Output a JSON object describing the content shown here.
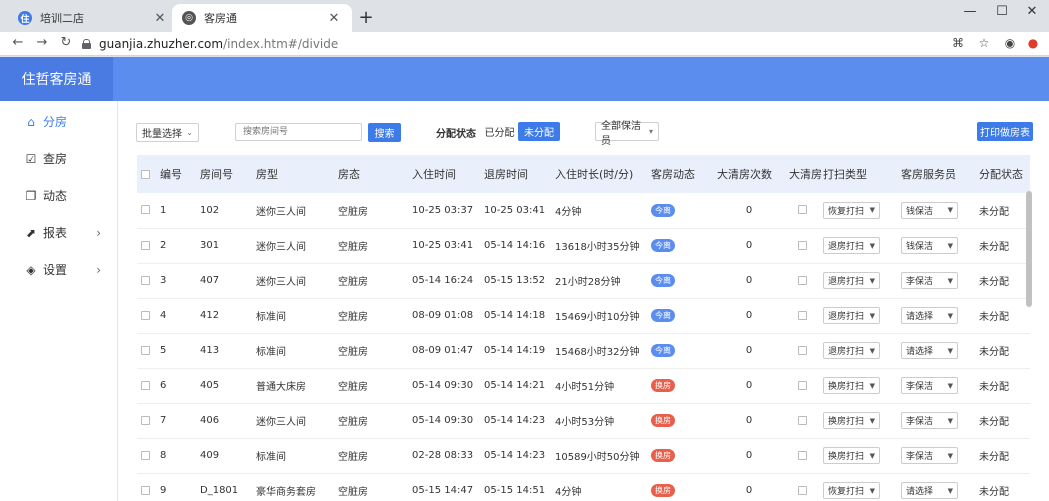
{
  "browser": {
    "tabs": [
      {
        "title": "培训二店",
        "favicon_color": "#3d7be8",
        "favicon_glyph": "住"
      },
      {
        "title": "客房通",
        "favicon_color": "#555555",
        "favicon_glyph": "◎"
      }
    ],
    "url_host": "guanjia.zhuzher.com",
    "url_path": "/index.htm#/divide"
  },
  "app": {
    "brand": "住哲客房通",
    "accent": "#3d7be8",
    "header_color": "#5b8def"
  },
  "sidebar": {
    "items": [
      {
        "label": "分房",
        "icon": "home-icon",
        "glyph": "⌂",
        "active": true,
        "has_arrow": false
      },
      {
        "label": "查房",
        "icon": "checklist-icon",
        "glyph": "☑",
        "active": false,
        "has_arrow": false
      },
      {
        "label": "动态",
        "icon": "activity-icon",
        "glyph": "❐",
        "active": false,
        "has_arrow": false
      },
      {
        "label": "报表",
        "icon": "chart-icon",
        "glyph": "⬈",
        "active": false,
        "has_arrow": true
      },
      {
        "label": "设置",
        "icon": "settings-icon",
        "glyph": "◈",
        "active": false,
        "has_arrow": true
      }
    ]
  },
  "filters": {
    "batch_select": "批量选择",
    "search_placeholder": "搜索房间号",
    "search_button": "搜索",
    "status_label": "分配状态",
    "status_assigned": "已分配",
    "status_unassigned": "未分配",
    "cleaner_select": "全部保洁员",
    "print_button": "打印做房表"
  },
  "table": {
    "headers": [
      "编号",
      "房间号",
      "房型",
      "房态",
      "入住时间",
      "退房时间",
      "入住时长(时/分)",
      "客房动态",
      "大清房次数",
      "大清房",
      "打扫类型",
      "客房服务员",
      "分配状态"
    ],
    "rows": [
      {
        "no": "1",
        "room": "102",
        "type": "迷你三人间",
        "state": "空脏房",
        "checkin": "10-25 03:37",
        "checkout": "10-25 03:41",
        "duration": "4分钟",
        "dyn": "今离",
        "dyn_color": "#5b8def",
        "deep": "0",
        "clean": "恢复打扫",
        "staff": "钱保洁",
        "status": "未分配"
      },
      {
        "no": "2",
        "room": "301",
        "type": "迷你三人间",
        "state": "空脏房",
        "checkin": "10-25 03:41",
        "checkout": "05-14 14:16",
        "duration": "13618小时35分钟",
        "dyn": "今离",
        "dyn_color": "#5b8def",
        "deep": "0",
        "clean": "退房打扫",
        "staff": "钱保洁",
        "status": "未分配"
      },
      {
        "no": "3",
        "room": "407",
        "type": "迷你三人间",
        "state": "空脏房",
        "checkin": "05-14 16:24",
        "checkout": "05-15 13:52",
        "duration": "21小时28分钟",
        "dyn": "今离",
        "dyn_color": "#5b8def",
        "deep": "0",
        "clean": "退房打扫",
        "staff": "李保洁",
        "status": "未分配"
      },
      {
        "no": "4",
        "room": "412",
        "type": "标准间",
        "state": "空脏房",
        "checkin": "08-09 01:08",
        "checkout": "05-14 14:18",
        "duration": "15469小时10分钟",
        "dyn": "今离",
        "dyn_color": "#5b8def",
        "deep": "0",
        "clean": "退房打扫",
        "staff": "请选择",
        "status": "未分配"
      },
      {
        "no": "5",
        "room": "413",
        "type": "标准间",
        "state": "空脏房",
        "checkin": "08-09 01:47",
        "checkout": "05-14 14:19",
        "duration": "15468小时32分钟",
        "dyn": "今离",
        "dyn_color": "#5b8def",
        "deep": "0",
        "clean": "退房打扫",
        "staff": "请选择",
        "status": "未分配"
      },
      {
        "no": "6",
        "room": "405",
        "type": "普通大床房",
        "state": "空脏房",
        "checkin": "05-14 09:30",
        "checkout": "05-14 14:21",
        "duration": "4小时51分钟",
        "dyn": "换房",
        "dyn_color": "#e8604c",
        "deep": "0",
        "clean": "换房打扫",
        "staff": "李保洁",
        "status": "未分配"
      },
      {
        "no": "7",
        "room": "406",
        "type": "迷你三人间",
        "state": "空脏房",
        "checkin": "05-14 09:30",
        "checkout": "05-14 14:23",
        "duration": "4小时53分钟",
        "dyn": "换房",
        "dyn_color": "#e8604c",
        "deep": "0",
        "clean": "换房打扫",
        "staff": "李保洁",
        "status": "未分配"
      },
      {
        "no": "8",
        "room": "409",
        "type": "标准间",
        "state": "空脏房",
        "checkin": "02-28 08:33",
        "checkout": "05-14 14:23",
        "duration": "10589小时50分钟",
        "dyn": "换房",
        "dyn_color": "#e8604c",
        "deep": "0",
        "clean": "换房打扫",
        "staff": "李保洁",
        "status": "未分配"
      },
      {
        "no": "9",
        "room": "D_1801",
        "type": "豪华商务套房",
        "state": "空脏房",
        "checkin": "05-15 14:47",
        "checkout": "05-15 14:51",
        "duration": "4分钟",
        "dyn": "换房",
        "dyn_color": "#e8604c",
        "deep": "0",
        "clean": "恢复打扫",
        "staff": "请选择",
        "status": "未分配"
      }
    ]
  }
}
